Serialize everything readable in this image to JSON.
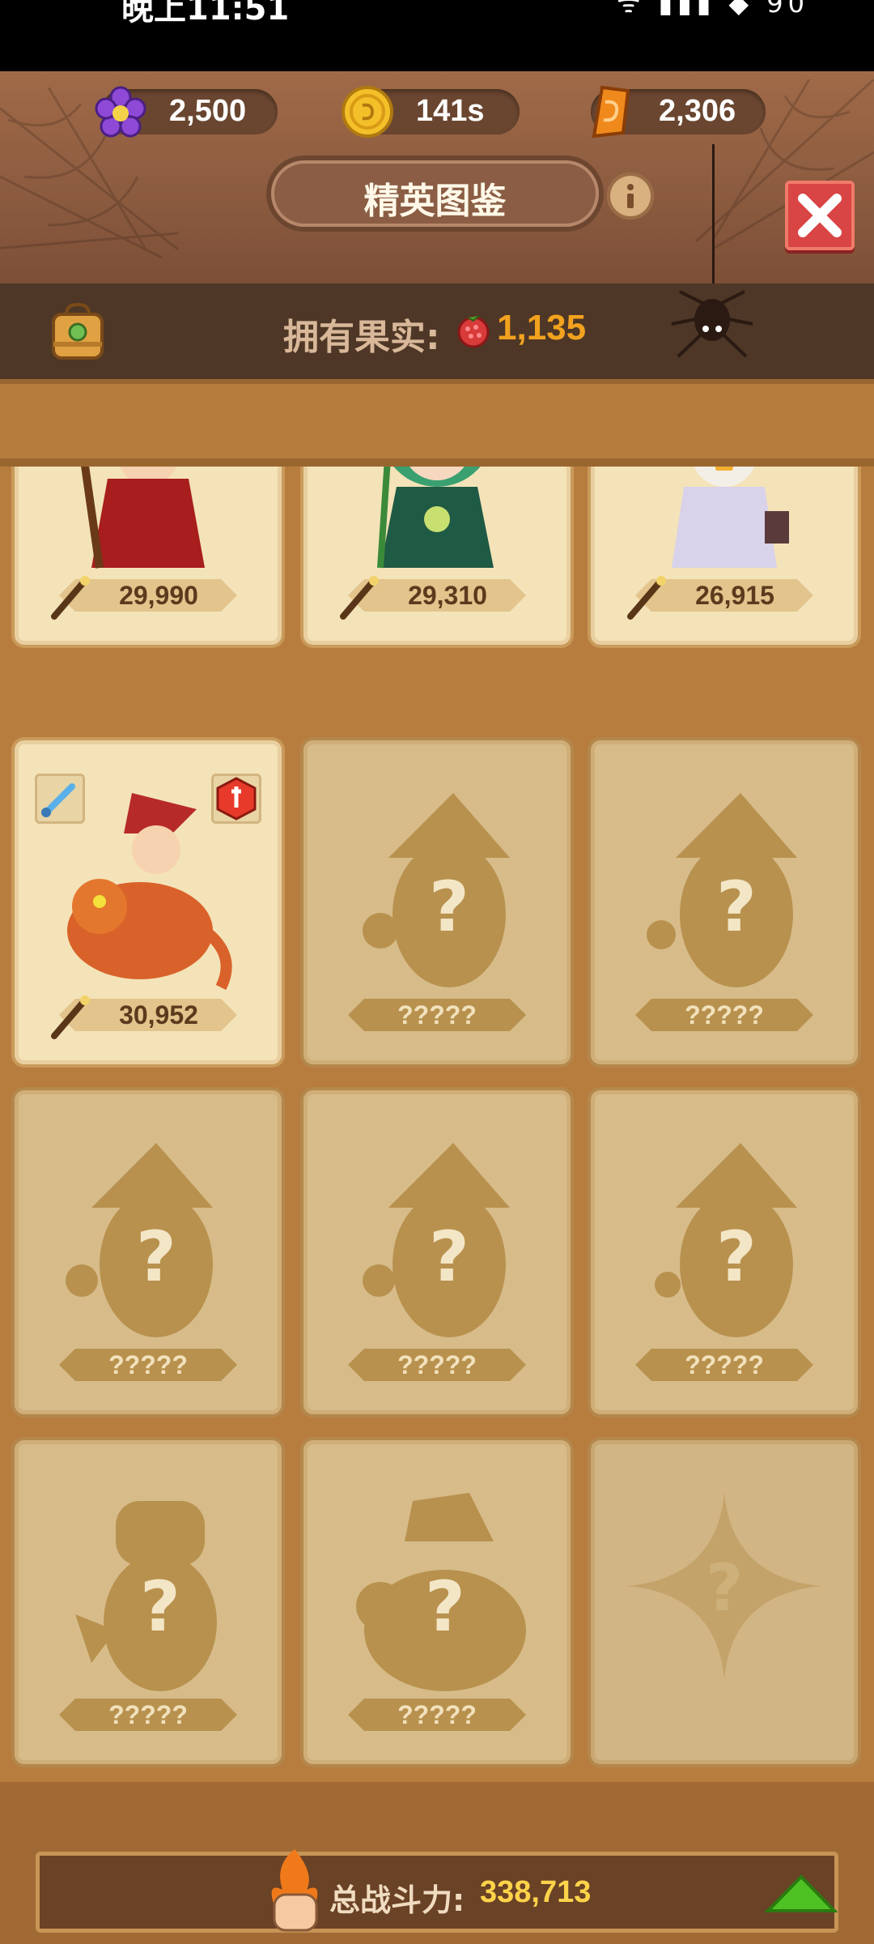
{
  "status_bar": {
    "time": "晚上11:51",
    "indicators": "ᯤ ▮▮▮ ◆ 90"
  },
  "currencies": [
    {
      "name": "gem",
      "icon": "purple-gem-icon",
      "value": "2,500"
    },
    {
      "name": "coin",
      "icon": "gold-coin-icon",
      "value": "141s"
    },
    {
      "name": "crystal",
      "icon": "orange-crystal-icon",
      "value": "2,306"
    }
  ],
  "title": "精英图鉴",
  "fruit": {
    "label": "拥有果实:",
    "value": "1,135"
  },
  "cards": [
    {
      "state": "owned",
      "power": "29,990",
      "hero": "red-wizard"
    },
    {
      "state": "owned",
      "power": "29,310",
      "hero": "green-elf"
    },
    {
      "state": "owned",
      "power": "26,915",
      "hero": "jester-priest"
    },
    {
      "state": "owned",
      "power": "30,952",
      "hero": "dragon-rider"
    },
    {
      "state": "locked",
      "label": "?????"
    },
    {
      "state": "locked",
      "label": "?????"
    },
    {
      "state": "locked",
      "label": "?????"
    },
    {
      "state": "locked",
      "label": "?????"
    },
    {
      "state": "locked",
      "label": "?????"
    },
    {
      "state": "locked",
      "label": "?????"
    },
    {
      "state": "locked",
      "label": "?????"
    },
    {
      "state": "empty"
    }
  ],
  "footer": {
    "label": "总战斗力:",
    "value": "338,713"
  },
  "colors": {
    "accent_orange": "#f2a21e",
    "power_yellow": "#ffd34a",
    "close_red": "#d94444",
    "up_green": "#4fc223"
  }
}
